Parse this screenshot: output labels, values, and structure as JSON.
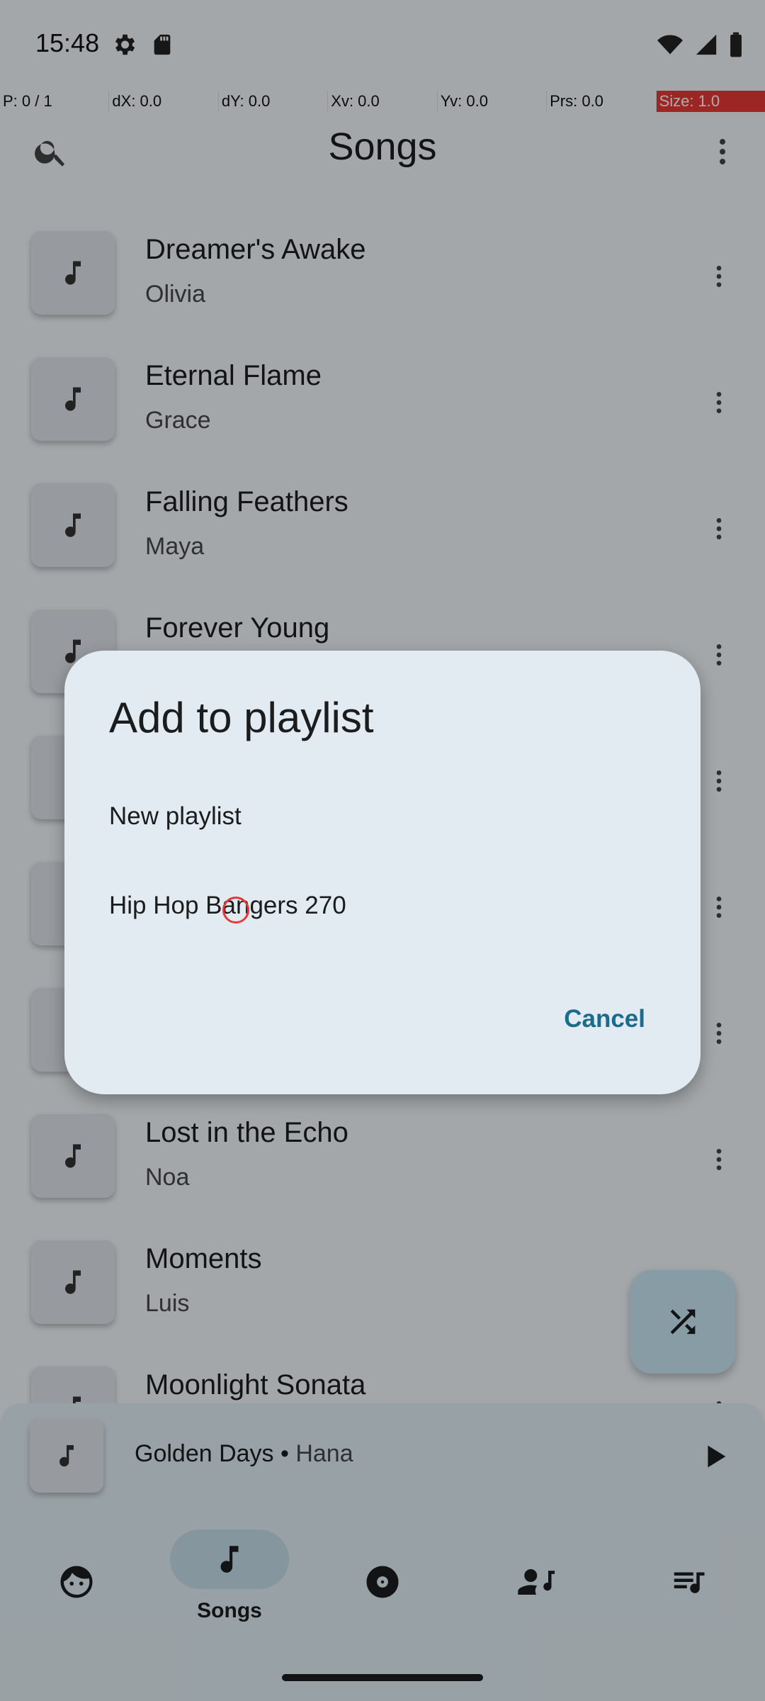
{
  "status_bar": {
    "time": "15:48",
    "icons_left": [
      "settings-icon",
      "sd-card-icon"
    ],
    "icons_right": [
      "wifi-icon",
      "signal-icon",
      "battery-icon"
    ]
  },
  "debug_overlay": {
    "pointer": "P: 0 / 1",
    "dx": "dX: 0.0",
    "dy": "dY: 0.0",
    "xv": "Xv: 0.0",
    "yv": "Yv: 0.0",
    "prs": "Prs: 0.0",
    "size": "Size: 1.0"
  },
  "top_bar": {
    "title": "Songs",
    "search_icon": "search-icon",
    "more_icon": "more-vert-icon"
  },
  "songs": [
    {
      "title": "Dreamer's Awake",
      "artist": "Olivia"
    },
    {
      "title": "Eternal Flame",
      "artist": "Grace"
    },
    {
      "title": "Falling Feathers",
      "artist": "Maya"
    },
    {
      "title": "Forever Young",
      "artist": ""
    },
    {
      "title": "",
      "artist": ""
    },
    {
      "title": "",
      "artist": ""
    },
    {
      "title": "",
      "artist": ""
    },
    {
      "title": "Lost in the Echo",
      "artist": "Noa"
    },
    {
      "title": "Moments",
      "artist": "Luis"
    },
    {
      "title": "Moonlight Sonata",
      "artist": ""
    }
  ],
  "fab": {
    "icon": "shuffle-icon"
  },
  "mini_player": {
    "song": "Golden Days",
    "separator": " • ",
    "artist": "Hana",
    "play_icon": "play-icon"
  },
  "bottom_nav": {
    "items": [
      {
        "label": "",
        "icon": "face-icon"
      },
      {
        "label": "Songs",
        "icon": "music-note-icon",
        "active": true
      },
      {
        "label": "",
        "icon": "album-icon"
      },
      {
        "label": "",
        "icon": "artist-icon"
      },
      {
        "label": "",
        "icon": "playlist-icon"
      }
    ]
  },
  "dialog": {
    "title": "Add to playlist",
    "options": [
      "New playlist",
      "Hip Hop Bangers 270"
    ],
    "cancel_label": "Cancel"
  },
  "colors": {
    "accent": "#1b6b8c",
    "scrim": "rgba(0,0,0,0.32)",
    "touch_marker": "#e53935"
  }
}
